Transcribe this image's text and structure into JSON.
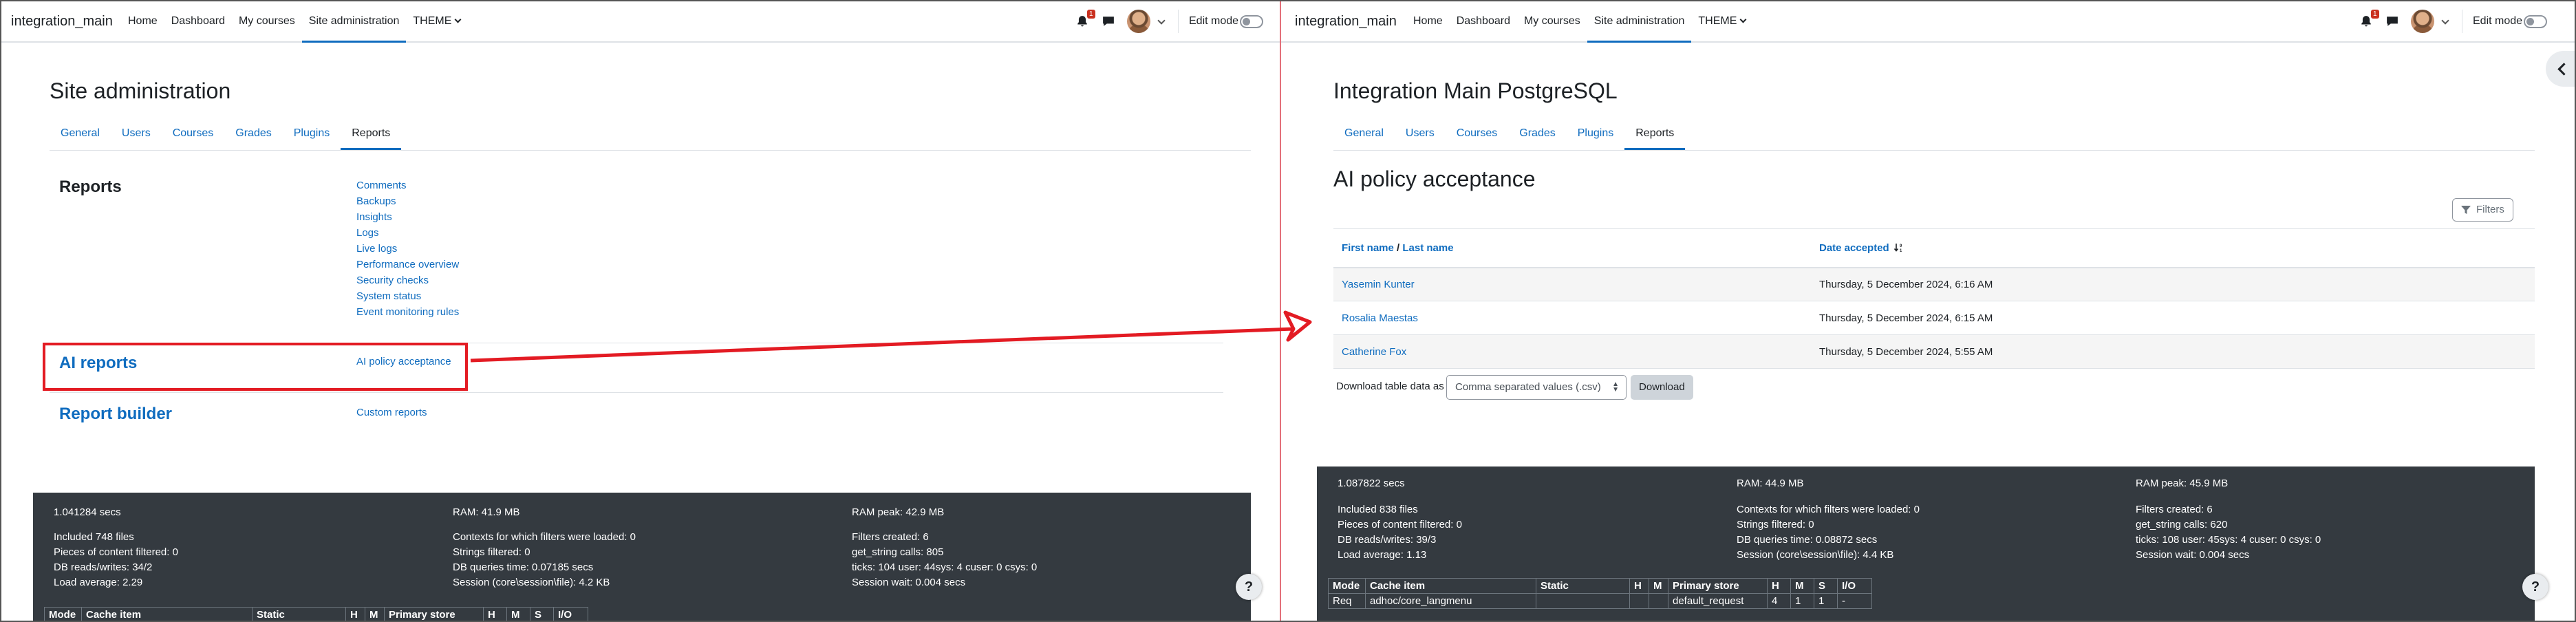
{
  "navbar": {
    "brand": "integration_main",
    "items": [
      "Home",
      "Dashboard",
      "My courses",
      "Site administration",
      "THEME"
    ],
    "notification_count": "1",
    "edit_mode_label": "Edit mode"
  },
  "left": {
    "page_title": "Site administration",
    "tabs": [
      "General",
      "Users",
      "Courses",
      "Grades",
      "Plugins",
      "Reports"
    ],
    "sections": {
      "reports_title": "Reports",
      "reports_links": [
        "Comments",
        "Backups",
        "Insights",
        "Logs",
        "Live logs",
        "Performance overview",
        "Security checks",
        "System status",
        "Event monitoring rules"
      ],
      "ai_title": "AI reports",
      "ai_link": "AI policy acceptance",
      "rb_title": "Report builder",
      "rb_link": "Custom reports"
    },
    "footer": {
      "col1": [
        "1.041284 secs",
        "Included 748 files",
        "Pieces of content filtered: 0",
        "DB reads/writes: 34/2",
        "Load average: 2.29"
      ],
      "col2": [
        "RAM: 41.9 MB",
        "Contexts for which filters were loaded: 0",
        "Strings filtered: 0",
        "DB queries time: 0.07185 secs",
        "Session (core\\session\\file): 4.2 KB"
      ],
      "col3": [
        "RAM peak: 42.9 MB",
        "Filters created: 6",
        "get_string calls: 805",
        "ticks: 104 user: 44sys: 4 cuser: 0 csys: 0",
        "Session wait: 0.004 secs"
      ],
      "table_headers": [
        "Mode",
        "Cache item",
        "Static",
        "H",
        "M",
        "Primary store",
        "H",
        "M",
        "S",
        "I/O"
      ]
    }
  },
  "right": {
    "page_title": "Integration Main PostgreSQL",
    "tabs": [
      "General",
      "Users",
      "Courses",
      "Grades",
      "Plugins",
      "Reports"
    ],
    "heading": "AI policy acceptance",
    "filters_label": "Filters",
    "table": {
      "col_first": "First name",
      "col_sep": "/",
      "col_last": "Last name",
      "col_date": "Date accepted",
      "rows": [
        {
          "name": "Yasemin Kunter",
          "date": "Thursday, 5 December 2024, 6:16 AM"
        },
        {
          "name": "Rosalia Maestas",
          "date": "Thursday, 5 December 2024, 6:15 AM"
        },
        {
          "name": "Catherine Fox",
          "date": "Thursday, 5 December 2024, 5:55 AM"
        }
      ]
    },
    "download_label": "Download table data as",
    "download_format": "Comma separated values (.csv)",
    "download_button": "Download",
    "footer": {
      "col1": [
        "1.087822 secs",
        "Included 838 files",
        "Pieces of content filtered: 0",
        "DB reads/writes: 39/3",
        "Load average: 1.13"
      ],
      "col2": [
        "RAM: 44.9 MB",
        "Contexts for which filters were loaded: 0",
        "Strings filtered: 0",
        "DB queries time: 0.08872 secs",
        "Session (core\\session\\file): 4.4 KB"
      ],
      "col3": [
        "RAM peak: 45.9 MB",
        "Filters created: 6",
        "get_string calls: 620",
        "ticks: 108 user: 45sys: 4 cuser: 0 csys: 0",
        "Session wait: 0.004 secs"
      ],
      "table_headers": [
        "Mode",
        "Cache item",
        "Static",
        "H",
        "M",
        "Primary store",
        "H",
        "M",
        "S",
        "I/O"
      ],
      "table_row": [
        "Req",
        "adhoc/core_langmenu",
        "",
        "",
        "",
        "default_request",
        "4",
        "1",
        "1",
        "-"
      ]
    }
  },
  "help_label": "?",
  "colors": {
    "link": "#0f6cbf",
    "highlight": "#e31b23",
    "footer": "#343a40"
  }
}
